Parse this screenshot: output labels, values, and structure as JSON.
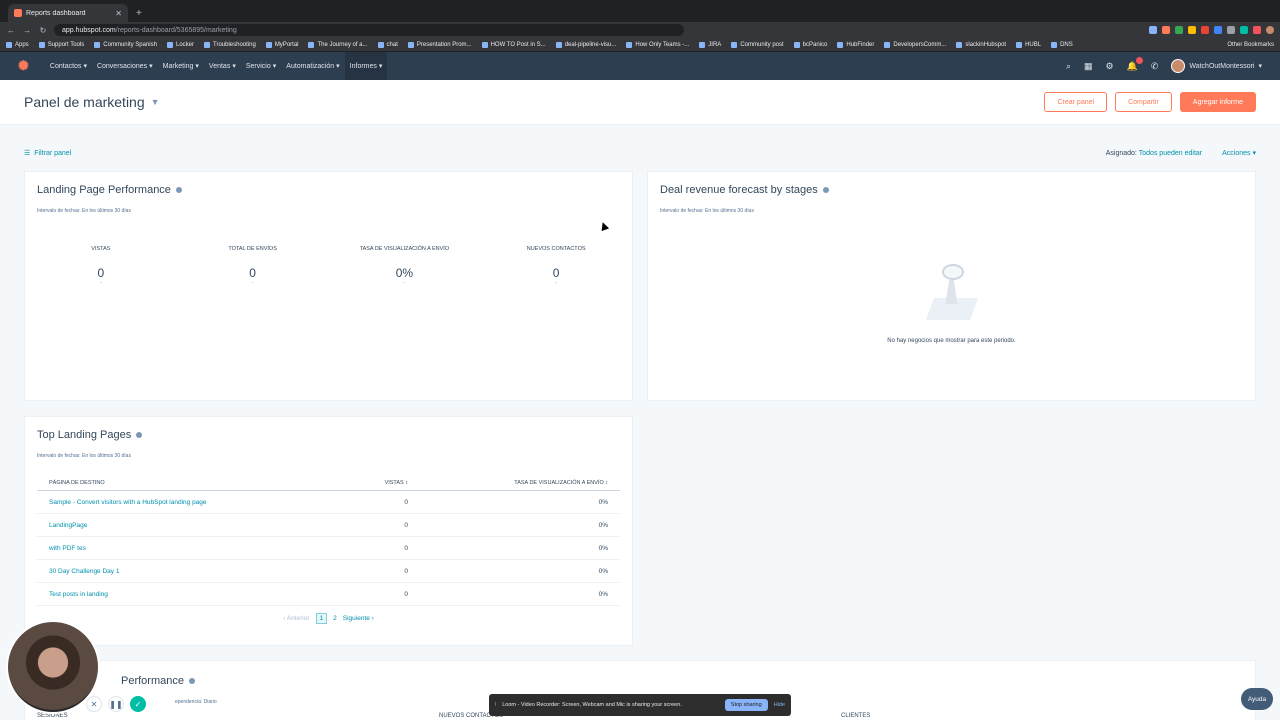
{
  "browser": {
    "tab_title": "Reports dashboard",
    "url_host": "app.hubspot.com",
    "url_path": "/reports-dashboard/5365895/marketing",
    "bookmarks": [
      "Apps",
      "Support Tools",
      "Community Spanish",
      "Locker",
      "Troubleshooting",
      "MyPortal",
      "The Journey of a...",
      "chat",
      "Presentation Prom...",
      "HOW TO Post in S...",
      "deal-pipeline-visu...",
      "How Only Teams -...",
      "JIRA",
      "Community post",
      "bcPanico",
      "HubFinder",
      "DevelopersComm...",
      "slackinHubspot",
      "HUBL",
      "DNS"
    ],
    "other_bookmarks": "Other Bookmarks"
  },
  "hs_nav": {
    "items": [
      "Contactos",
      "Conversaciones",
      "Marketing",
      "Ventas",
      "Servicio",
      "Automatización",
      "Informes"
    ],
    "account_name": "WatchOutMontessori"
  },
  "header": {
    "title": "Panel de marketing",
    "btn_create": "Crear panel",
    "btn_share": "Compartir",
    "btn_add": "Agregar informe"
  },
  "filters": {
    "filter_label": "Filtrar panel",
    "assigned_label": "Asignado:",
    "assigned_value": "Todos pueden editar",
    "actions": "Acciones"
  },
  "landing_perf": {
    "title": "Landing Page Performance",
    "subtitle": "Intervalo de fechas: En los últimos 30 días",
    "kpis": [
      {
        "label": "VISTAS",
        "value": "0"
      },
      {
        "label": "TOTAL DE ENVÍOS",
        "value": "0"
      },
      {
        "label": "TASA DE VISUALIZACIÓN A ENVÍO",
        "value": "0%"
      },
      {
        "label": "NUEVOS CONTACTOS",
        "value": "0"
      }
    ]
  },
  "deal_forecast": {
    "title": "Deal revenue forecast by stages",
    "subtitle": "Intervalo de fechas: En los últimos 30 días",
    "empty_text": "No hay negocios que mostrar para este periodo."
  },
  "top_pages": {
    "title": "Top Landing Pages",
    "subtitle": "Intervalo de fechas: En los últimos 30 días",
    "columns": [
      "PÁGINA DE DESTINO",
      "VISTAS",
      "TASA DE VISUALIZACIÓN A ENVÍO"
    ],
    "rows": [
      {
        "page": "Sample - Convert visitors with a HubSpot landing page",
        "views": "0",
        "rate": "0%"
      },
      {
        "page": "LandingPage",
        "views": "0",
        "rate": "0%"
      },
      {
        "page": "with PDF tes",
        "views": "0",
        "rate": "0%"
      },
      {
        "page": "30 Day Challenge Day 1",
        "views": "0",
        "rate": "0%"
      },
      {
        "page": "Test posts in landing",
        "views": "0",
        "rate": "0%"
      }
    ],
    "pager": {
      "prev": "Anterior",
      "current": "1",
      "next_page": "2",
      "next": "Siguiente"
    }
  },
  "bottom": {
    "title": "Performance",
    "subtitle": "ependencia: Diario",
    "columns": [
      "SESIONES",
      "NUEVOS CONTACTOS",
      "CLIENTES"
    ]
  },
  "screen_share": {
    "text": "Loom - Video Recorder: Screen, Webcam and Mic is sharing your screen.",
    "stop": "Stop sharing",
    "hide": "Hide"
  },
  "help": "Ayuda",
  "colors": {
    "accent": "#ff7a59",
    "nav": "#2d3e50",
    "link": "#0091ae"
  }
}
